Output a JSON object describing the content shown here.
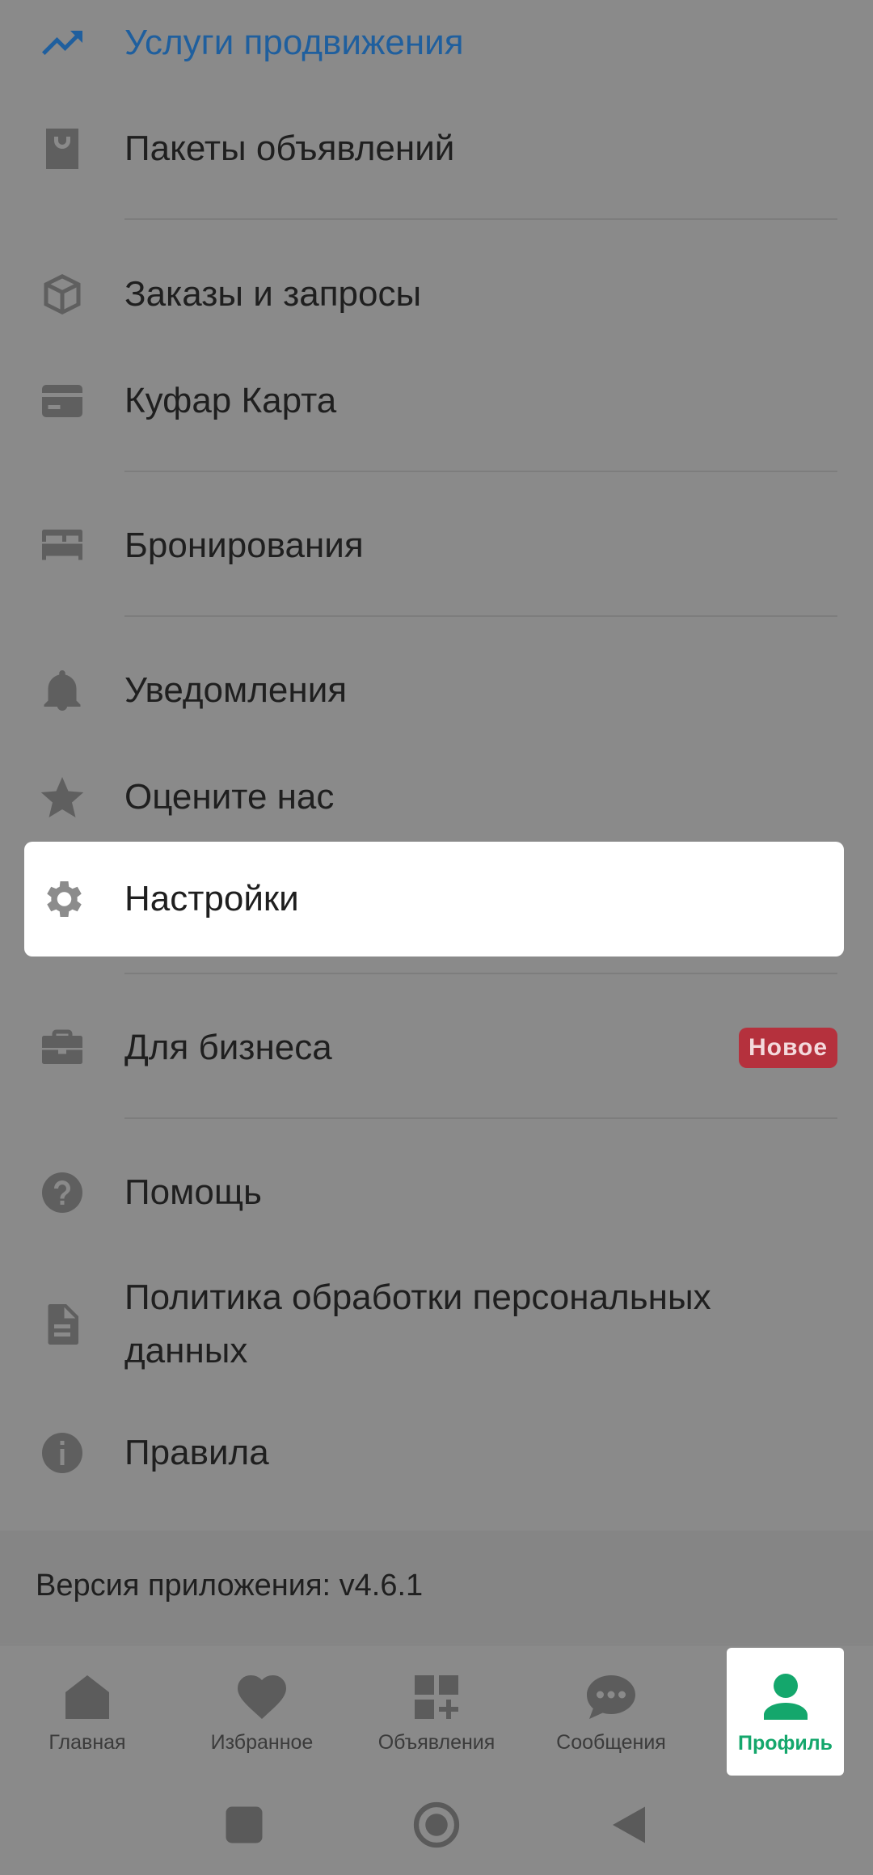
{
  "menu": {
    "promo": {
      "label": "Услуги продвижения",
      "icon": "trending-up-icon",
      "color": "#1f5f9e"
    },
    "packages": {
      "label": "Пакеты объявлений",
      "icon": "shopping-bag-icon"
    },
    "orders": {
      "label": "Заказы и запросы",
      "icon": "package-box-icon"
    },
    "card": {
      "label": "Куфар Карта",
      "icon": "credit-card-icon"
    },
    "bookings": {
      "label": "Бронирования",
      "icon": "bed-icon"
    },
    "notifications": {
      "label": "Уведомления",
      "icon": "bell-icon"
    },
    "rate": {
      "label": "Оцените нас",
      "icon": "star-icon"
    },
    "settings": {
      "label": "Настройки",
      "icon": "gear-icon"
    },
    "business": {
      "label": "Для бизнеса",
      "icon": "briefcase-icon",
      "badge": "Новое",
      "badge_color": "#b5313d"
    },
    "help": {
      "label": "Помощь",
      "icon": "help-circle-icon"
    },
    "privacy": {
      "label": "Политика обработки персональных данных",
      "icon": "document-icon"
    },
    "rules": {
      "label": "Правила",
      "icon": "info-icon"
    }
  },
  "version": {
    "text": "Версия приложения: v4.6.1"
  },
  "bottom_nav": {
    "items": [
      {
        "label": "Главная",
        "icon": "home-icon"
      },
      {
        "label": "Избранное",
        "icon": "heart-icon"
      },
      {
        "label": "Объявления",
        "icon": "ads-grid-plus-icon"
      },
      {
        "label": "Сообщения",
        "icon": "chat-bubble-icon"
      },
      {
        "label": "Профиль",
        "icon": "person-icon",
        "active": true,
        "color": "#14a76c"
      }
    ]
  },
  "system_nav": {
    "buttons": [
      "recents-square-icon",
      "home-circle-icon",
      "back-triangle-icon"
    ]
  }
}
